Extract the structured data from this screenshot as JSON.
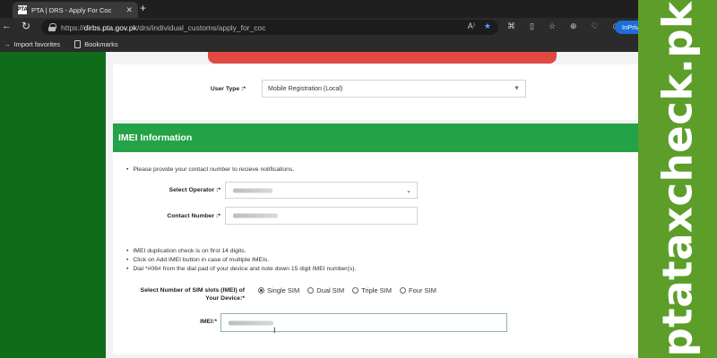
{
  "browser": {
    "tab_title": "PTA | DRS - Apply For Coc",
    "tab_favicon": "PTA",
    "url_prefix": "https://",
    "url_domain": "dirbs.pta.gov.pk",
    "url_path": "/drs/individual_customs/apply_for_coc",
    "inprivate_label": "InPriv",
    "favorites": [
      "Import favorites",
      "Bookmarks"
    ]
  },
  "form": {
    "user_type_label": "User Type :*",
    "user_type_value": "Mobile Registration (Local)",
    "section_title": "IMEI Information",
    "contact_note": "Please provide your contact number to recieve notifications.",
    "operator_label": "Select Operator :*",
    "contact_label": "Contact Number :*",
    "notes": [
      "IMEI duplication check is on first 14 digits.",
      "Click on Add IMEI button in case of multiple IMEIs.",
      "Dial *#06# from the dial pad of your device and note down 15 digit IMEI number(s)."
    ],
    "sim_slots_label": "Select Number of SIM slots (IMEI) of Your Device:*",
    "sim_options": [
      "Single SIM",
      "Dual SIM",
      "Triple SIM",
      "Four SIM"
    ],
    "sim_selected": "Single SIM",
    "imei_label": "IMEI:*"
  },
  "watermark": {
    "text": "ptataxcheck.pk"
  },
  "colors": {
    "left_green": "#0f6d1a",
    "section_green": "#23a247",
    "red_button": "#e04a43",
    "right_strip": "#5c9e29"
  }
}
